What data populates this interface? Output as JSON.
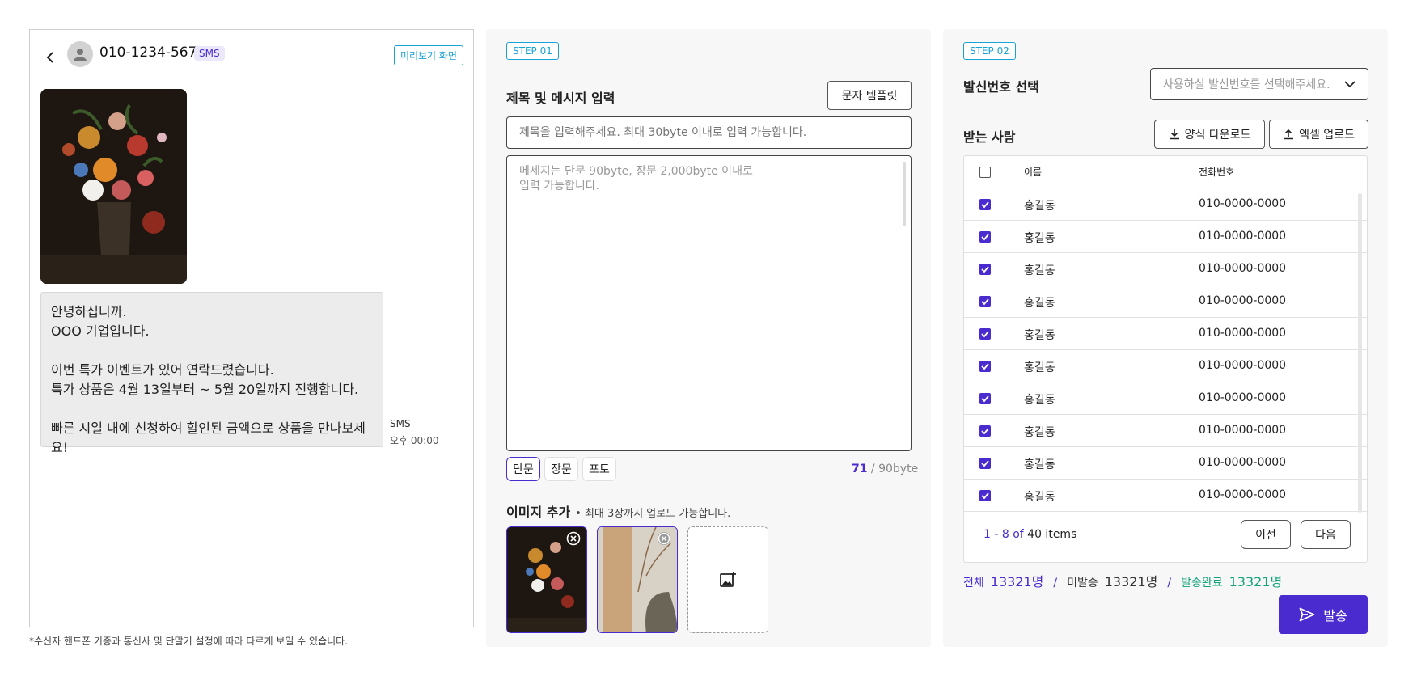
{
  "preview": {
    "phone_number": "010-1234-5678",
    "type_badge": "SMS",
    "preview_button": "미리보기 화면",
    "message_text": "안녕하십니까.\nOOO 기업입니다.\n\n이번 특가 이벤트가 있어 연락드렸습니다.\n특가 상품은 4월 13일부터 ~ 5월 20일까지 진행합니다.\n\n빠른 시일 내에 신청하여 할인된 금액으로 상품을 만나보세요!",
    "meta_type": "SMS",
    "meta_time": "오후 00:00",
    "footnote": "*수신자 핸드폰 기종과 통신사 및 단말기 설정에 따라 다르게 보일 수 있습니다."
  },
  "step1": {
    "badge": "STEP 01",
    "title": "제목 및 메시지 입력",
    "template_button": "문자 템플릿",
    "subject_placeholder": "제목을 입력해주세요. 최대 30byte 이내로 입력 가능합니다.",
    "message_placeholder": "메세지는 단문 90byte, 장문 2,000byte 이내로\n입력 가능합니다.",
    "types": [
      "단문",
      "장문",
      "포토"
    ],
    "active_type": "단문",
    "byte_count": "71",
    "byte_limit": " / 90byte",
    "image_title": "이미지 추가",
    "image_hint": "• 최대 3장까지 업로드 가능합니다."
  },
  "step2": {
    "badge": "STEP 02",
    "sender_title": "발신번호 선택",
    "sender_placeholder": "사용하실 발신번호를 선택해주세요.",
    "recipients_title": "받는 사람",
    "download_button": "양식 다운로드",
    "upload_button": "엑셀 업로드",
    "table": {
      "headers": [
        "이름",
        "전화번호"
      ],
      "rows": [
        {
          "name": "홍길동",
          "phone": "010-0000-0000",
          "checked": true
        },
        {
          "name": "홍길동",
          "phone": "010-0000-0000",
          "checked": true
        },
        {
          "name": "홍길동",
          "phone": "010-0000-0000",
          "checked": true
        },
        {
          "name": "홍길동",
          "phone": "010-0000-0000",
          "checked": true
        },
        {
          "name": "홍길동",
          "phone": "010-0000-0000",
          "checked": true
        },
        {
          "name": "홍길동",
          "phone": "010-0000-0000",
          "checked": true
        },
        {
          "name": "홍길동",
          "phone": "010-0000-0000",
          "checked": true
        },
        {
          "name": "홍길동",
          "phone": "010-0000-0000",
          "checked": true
        },
        {
          "name": "홍길동",
          "phone": "010-0000-0000",
          "checked": true
        },
        {
          "name": "홍길동",
          "phone": "010-0000-0000",
          "checked": true
        }
      ],
      "range": "1 - 8 of",
      "total": " 40 items",
      "prev_button": "이전",
      "next_button": "다음"
    },
    "summary": {
      "total_label": "전체",
      "total_value": "13321명",
      "sep": "/",
      "unsent_label": "미발송",
      "unsent_value": "13321명",
      "sent_label": "발송완료",
      "sent_value": "13321명"
    },
    "send_button": "발송"
  },
  "colors": {
    "accent": "#4a2bd0",
    "step_badge": "#19a2d6",
    "sent": "#12a37a"
  }
}
